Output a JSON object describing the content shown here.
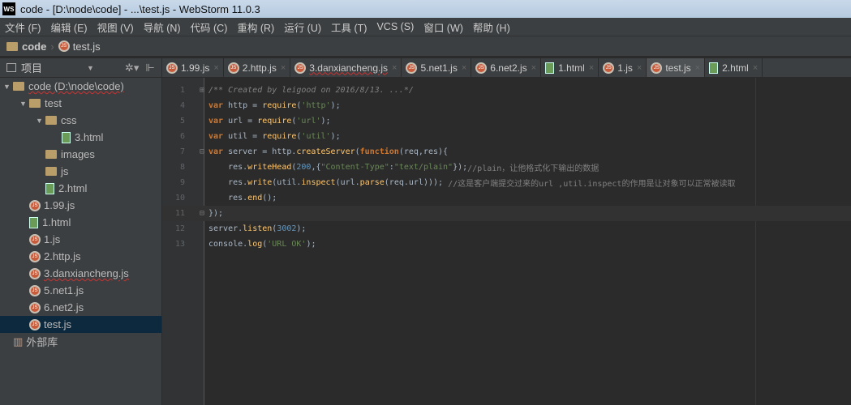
{
  "window": {
    "title": "code - [D:\\node\\code] - ...\\test.js - WebStorm 11.0.3",
    "logo": "WS"
  },
  "menu": [
    "文件 (F)",
    "编辑 (E)",
    "视图 (V)",
    "导航 (N)",
    "代码 (C)",
    "重构 (R)",
    "运行 (U)",
    "工具 (T)",
    "VCS (S)",
    "窗口 (W)",
    "帮助 (H)"
  ],
  "breadcrumb": {
    "root": "code",
    "file": "test.js"
  },
  "project_panel": {
    "title": "项目",
    "settings_icon": "gear-icon",
    "collapse_icon": "collapse-icon"
  },
  "tabs": [
    {
      "label": "1.99.js",
      "icon": "js"
    },
    {
      "label": "2.http.js",
      "icon": "js"
    },
    {
      "label": "3.danxiancheng.js",
      "icon": "js",
      "error": true
    },
    {
      "label": "5.net1.js",
      "icon": "js"
    },
    {
      "label": "6.net2.js",
      "icon": "js"
    },
    {
      "label": "1.html",
      "icon": "html"
    },
    {
      "label": "1.js",
      "icon": "js"
    },
    {
      "label": "test.js",
      "icon": "js",
      "active": true
    },
    {
      "label": "2.html",
      "icon": "html"
    }
  ],
  "tree": [
    {
      "label": "code (D:\\node\\code)",
      "icon": "folder",
      "depth": 0,
      "arrow": "▼",
      "error": true
    },
    {
      "label": "test",
      "icon": "folder",
      "depth": 1,
      "arrow": "▼"
    },
    {
      "label": "css",
      "icon": "folder",
      "depth": 2,
      "arrow": "▼"
    },
    {
      "label": "3.html",
      "icon": "html",
      "depth": 3
    },
    {
      "label": "images",
      "icon": "folder",
      "depth": 2
    },
    {
      "label": "js",
      "icon": "folder",
      "depth": 2
    },
    {
      "label": "2.html",
      "icon": "html",
      "depth": 2
    },
    {
      "label": "1.99.js",
      "icon": "js",
      "depth": 1
    },
    {
      "label": "1.html",
      "icon": "html",
      "depth": 1
    },
    {
      "label": "1.js",
      "icon": "js",
      "depth": 1
    },
    {
      "label": "2.http.js",
      "icon": "js",
      "depth": 1
    },
    {
      "label": "3.danxiancheng.js",
      "icon": "js",
      "depth": 1,
      "error": true
    },
    {
      "label": "5.net1.js",
      "icon": "js",
      "depth": 1
    },
    {
      "label": "6.net2.js",
      "icon": "js",
      "depth": 1
    },
    {
      "label": "test.js",
      "icon": "js",
      "depth": 1,
      "selected": true
    },
    {
      "label": "外部库",
      "icon": "library",
      "depth": 0
    }
  ],
  "code": [
    {
      "n": "1",
      "fold": "+",
      "tokens": [
        [
          "cm",
          "/** Created by leigood on 2016/8/13. ...*/"
        ]
      ]
    },
    {
      "n": "4",
      "tokens": [
        [
          "kw",
          "var"
        ],
        [
          "df",
          " http = "
        ],
        [
          "fn",
          "require"
        ],
        [
          "df",
          "("
        ],
        [
          "st",
          "'http'"
        ],
        [
          "df",
          ");"
        ]
      ]
    },
    {
      "n": "5",
      "tokens": [
        [
          "kw",
          "var"
        ],
        [
          "df",
          " url = "
        ],
        [
          "fn",
          "require"
        ],
        [
          "df",
          "("
        ],
        [
          "st",
          "'url'"
        ],
        [
          "df",
          ");"
        ]
      ]
    },
    {
      "n": "6",
      "tokens": [
        [
          "kw",
          "var"
        ],
        [
          "df",
          " util = "
        ],
        [
          "fn",
          "require"
        ],
        [
          "df",
          "("
        ],
        [
          "st",
          "'util'"
        ],
        [
          "df",
          ");"
        ]
      ]
    },
    {
      "n": "7",
      "fold": "-",
      "tokens": [
        [
          "kw",
          "var"
        ],
        [
          "df",
          " server = http."
        ],
        [
          "fn",
          "createServer"
        ],
        [
          "df",
          "("
        ],
        [
          "kw",
          "function"
        ],
        [
          "df",
          "(req,res){"
        ]
      ]
    },
    {
      "n": "8",
      "tokens": [
        [
          "df",
          "    res."
        ],
        [
          "fn",
          "writeHead"
        ],
        [
          "df",
          "("
        ],
        [
          "nu",
          "200"
        ],
        [
          "df",
          ",{"
        ],
        [
          "st",
          "\"Content-Type\""
        ],
        [
          "df",
          ":"
        ],
        [
          "st",
          "\"text/plain\""
        ],
        [
          "df",
          "});"
        ],
        [
          "lc",
          "//plain，让他格式化下输出的数据"
        ]
      ]
    },
    {
      "n": "9",
      "tokens": [
        [
          "df",
          "    res."
        ],
        [
          "fn",
          "write"
        ],
        [
          "df",
          "(util."
        ],
        [
          "fn",
          "inspect"
        ],
        [
          "df",
          "(url."
        ],
        [
          "fn",
          "parse"
        ],
        [
          "df",
          "(req.url))); "
        ],
        [
          "lc",
          "//这是客户端提交过来的url ,util.inspect的作用是让对象可以正常被读取"
        ]
      ]
    },
    {
      "n": "10",
      "tokens": [
        [
          "df",
          "    res."
        ],
        [
          "fn",
          "end"
        ],
        [
          "df",
          "();"
        ]
      ]
    },
    {
      "n": "11",
      "fold": "-",
      "caret": true,
      "tokens": [
        [
          "df",
          "});"
        ]
      ]
    },
    {
      "n": "12",
      "tokens": [
        [
          "df",
          "server."
        ],
        [
          "fn",
          "listen"
        ],
        [
          "df",
          "("
        ],
        [
          "nu",
          "3002"
        ],
        [
          "df",
          ");"
        ]
      ]
    },
    {
      "n": "13",
      "tokens": [
        [
          "df",
          "console."
        ],
        [
          "fn",
          "log"
        ],
        [
          "df",
          "("
        ],
        [
          "st",
          "'URL OK'"
        ],
        [
          "df",
          ");"
        ]
      ]
    }
  ]
}
